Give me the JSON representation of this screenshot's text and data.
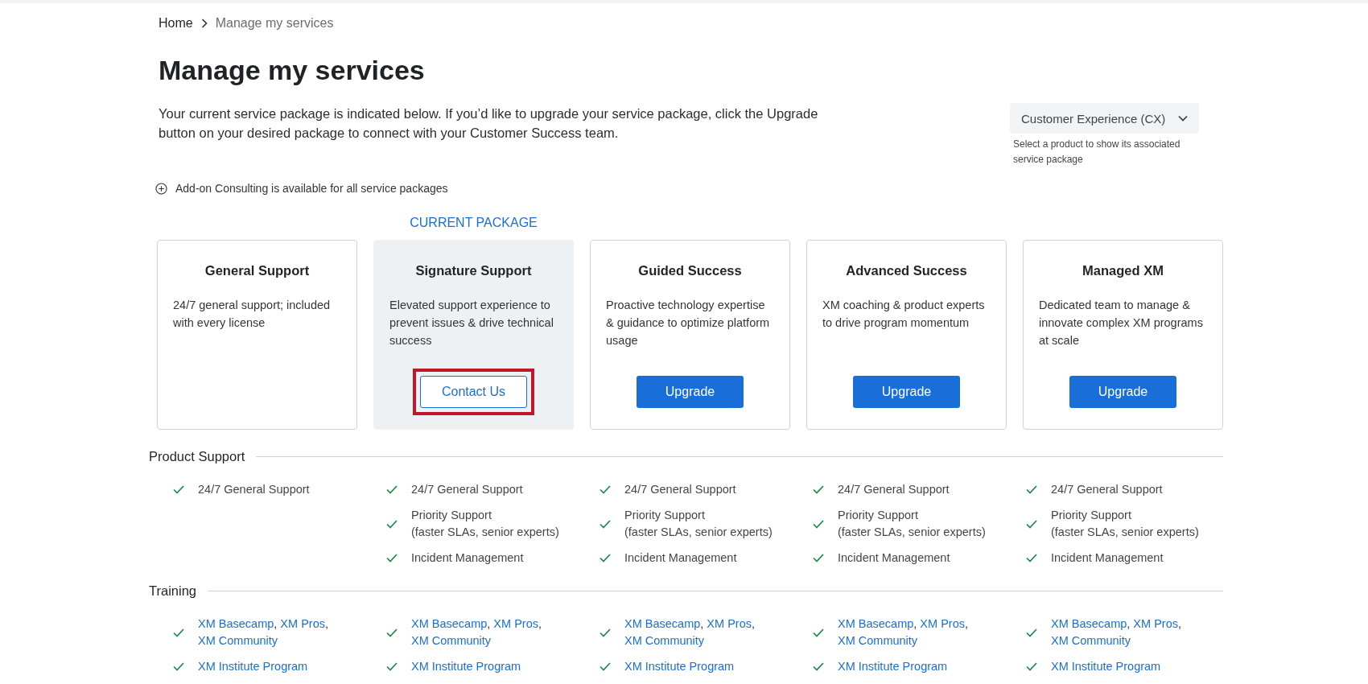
{
  "breadcrumb": [
    {
      "label": "Home",
      "current": false
    },
    {
      "label": "Manage my services",
      "current": true
    }
  ],
  "title": "Manage my services",
  "intro": "Your current service package is indicated below. If you’d like to upgrade your service package, click the Upgrade button on your desired package to connect with your Customer Success team.",
  "product_select": {
    "value": "Customer Experience (CX)",
    "help": "Select a product to show its associated service package"
  },
  "addon_note": "Add-on Consulting is available for all service packages",
  "current_label": "CURRENT PACKAGE",
  "packages": [
    {
      "name": "General Support",
      "description": "24/7 general support; included with every license",
      "selected": false
    },
    {
      "name": "Signature Support",
      "description": "Elevated support experience to prevent issues & drive technical success",
      "selected": true,
      "button": {
        "label": "Contact Us",
        "kind": "outline",
        "highlighted": true
      }
    },
    {
      "name": "Guided Success",
      "description": "Proactive technology expertise & guidance to optimize platform usage",
      "selected": false,
      "button": {
        "label": "Upgrade",
        "kind": "primary",
        "highlighted": false
      }
    },
    {
      "name": "Advanced Success",
      "description": "XM coaching & product experts to drive program momentum",
      "selected": false,
      "button": {
        "label": "Upgrade",
        "kind": "primary",
        "highlighted": false
      }
    },
    {
      "name": "Managed XM",
      "description": "Dedicated team to manage & innovate complex XM programs at scale",
      "selected": false,
      "button": {
        "label": "Upgrade",
        "kind": "primary",
        "highlighted": false
      }
    }
  ],
  "sections": [
    {
      "title": "Product Support",
      "columns": [
        [
          {
            "kind": "text",
            "lines": [
              "24/7 General Support"
            ]
          }
        ],
        [
          {
            "kind": "text",
            "lines": [
              "24/7 General Support"
            ]
          },
          {
            "kind": "text",
            "lines": [
              "Priority Support",
              "(faster SLAs, senior experts)"
            ]
          },
          {
            "kind": "text",
            "lines": [
              "Incident Management"
            ]
          }
        ],
        [
          {
            "kind": "text",
            "lines": [
              "24/7 General Support"
            ]
          },
          {
            "kind": "text",
            "lines": [
              "Priority Support",
              "(faster SLAs, senior experts)"
            ]
          },
          {
            "kind": "text",
            "lines": [
              "Incident Management"
            ]
          }
        ],
        [
          {
            "kind": "text",
            "lines": [
              "24/7 General Support"
            ]
          },
          {
            "kind": "text",
            "lines": [
              "Priority Support",
              "(faster SLAs, senior experts)"
            ]
          },
          {
            "kind": "text",
            "lines": [
              "Incident Management"
            ]
          }
        ],
        [
          {
            "kind": "text",
            "lines": [
              "24/7 General Support"
            ]
          },
          {
            "kind": "text",
            "lines": [
              "Priority Support",
              "(faster SLAs, senior experts)"
            ]
          },
          {
            "kind": "text",
            "lines": [
              "Incident Management"
            ]
          }
        ]
      ]
    },
    {
      "title": "Training",
      "columns": [
        [
          {
            "kind": "links",
            "links": [
              {
                "text": "XM Basecamp",
                "after": ","
              },
              {
                "text": "XM Pros",
                "after": ","
              },
              {
                "text": "XM Community"
              }
            ]
          },
          {
            "kind": "links",
            "links": [
              {
                "text": "XM Institute Program"
              }
            ]
          }
        ],
        [
          {
            "kind": "links",
            "links": [
              {
                "text": "XM Basecamp",
                "after": ","
              },
              {
                "text": "XM Pros",
                "after": ","
              },
              {
                "text": "XM Community"
              }
            ]
          },
          {
            "kind": "links",
            "links": [
              {
                "text": "XM Institute Program"
              }
            ]
          }
        ],
        [
          {
            "kind": "links",
            "links": [
              {
                "text": "XM Basecamp",
                "after": ","
              },
              {
                "text": "XM Pros",
                "after": ","
              },
              {
                "text": "XM Community"
              }
            ]
          },
          {
            "kind": "links",
            "links": [
              {
                "text": "XM Institute Program"
              }
            ]
          }
        ],
        [
          {
            "kind": "links",
            "links": [
              {
                "text": "XM Basecamp",
                "after": ","
              },
              {
                "text": "XM Pros",
                "after": ","
              },
              {
                "text": "XM Community"
              }
            ]
          },
          {
            "kind": "links",
            "links": [
              {
                "text": "XM Institute Program"
              }
            ]
          }
        ],
        [
          {
            "kind": "links",
            "links": [
              {
                "text": "XM Basecamp",
                "after": ","
              },
              {
                "text": "XM Pros",
                "after": ","
              },
              {
                "text": "XM Community"
              }
            ]
          },
          {
            "kind": "links",
            "links": [
              {
                "text": "XM Institute Program"
              }
            ]
          }
        ]
      ]
    }
  ]
}
